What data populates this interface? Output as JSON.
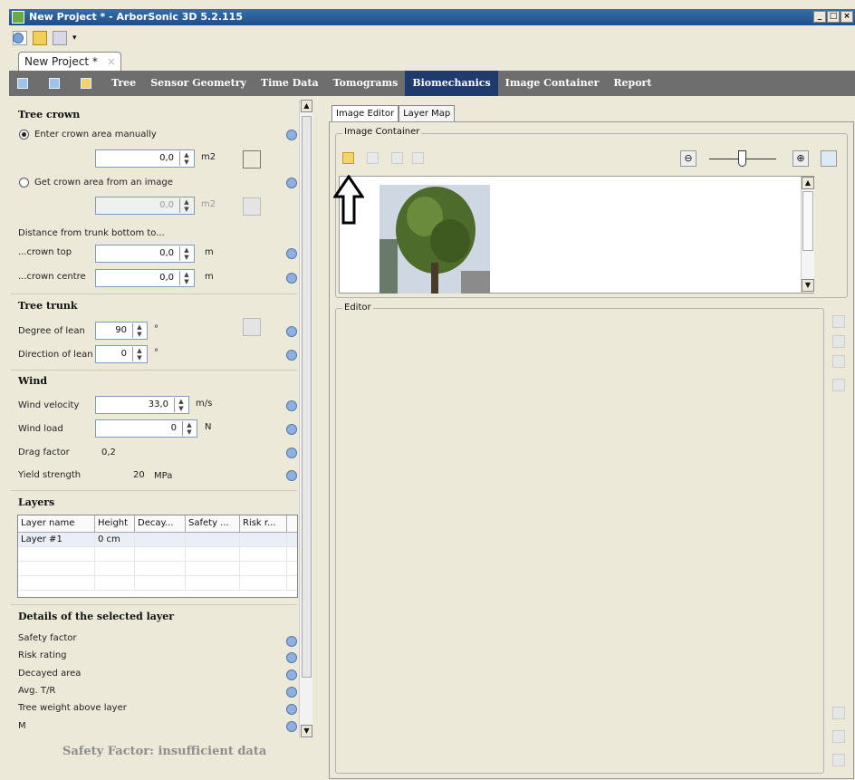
{
  "window": {
    "title": "New Project * - ArborSonic 3D 5.2.115",
    "buttons": [
      "_",
      "□",
      "×"
    ]
  },
  "doc_tab": {
    "label": "New Project *",
    "close": "×"
  },
  "menu": {
    "items": [
      "Tree",
      "Sensor Geometry",
      "Time Data",
      "Tomograms",
      "Biomechanics",
      "Image Container",
      "Report"
    ],
    "active": "Biomechanics"
  },
  "left": {
    "tree_crown": {
      "title": "Tree crown",
      "radio_manual": "Enter crown area manually",
      "manual_value": "0,0",
      "manual_unit": "m2",
      "radio_image": "Get crown area from an image",
      "image_value": "0,0",
      "image_unit": "m2",
      "distance_label": "Distance from trunk bottom to...",
      "crown_top_label": "...crown top",
      "crown_top_value": "0,0",
      "crown_top_unit": "m",
      "crown_centre_label": "...crown centre",
      "crown_centre_value": "0,0",
      "crown_centre_unit": "m"
    },
    "tree_trunk": {
      "title": "Tree trunk",
      "lean_degree_label": "Degree of lean",
      "lean_degree_value": "90",
      "lean_degree_unit": "°",
      "lean_dir_label": "Direction of lean",
      "lean_dir_value": "0",
      "lean_dir_unit": "°"
    },
    "wind": {
      "title": "Wind",
      "velocity_label": "Wind velocity",
      "velocity_value": "33,0",
      "velocity_unit": "m/s",
      "load_label": "Wind load",
      "load_value": "0",
      "load_unit": "N",
      "drag_label": "Drag factor",
      "drag_value": "0,2",
      "yield_label": "Yield strength",
      "yield_value": "20",
      "yield_unit": "MPa"
    },
    "layers": {
      "title": "Layers",
      "columns": [
        "Layer name",
        "Height",
        "Decay...",
        "Safety ...",
        "Risk r..."
      ],
      "rows": [
        [
          "Layer #1",
          "0 cm",
          "",
          "",
          ""
        ],
        [
          "",
          "",
          "",
          "",
          ""
        ],
        [
          "",
          "",
          "",
          "",
          ""
        ],
        [
          "",
          "",
          "",
          "",
          ""
        ]
      ]
    },
    "details": {
      "title": "Details of the selected layer",
      "items": [
        "Safety factor",
        "Risk rating",
        "Decayed area",
        "Avg. T/R",
        "Tree weight above layer",
        "M"
      ]
    },
    "status": "Safety Factor: insufficient data"
  },
  "right": {
    "tabs": [
      "Image Editor",
      "Layer Map"
    ],
    "active_tab": "Image Editor",
    "image_container_label": "Image Container",
    "editor_label": "Editor",
    "zoom_level": 0.5
  },
  "colors": {
    "menubar": "#6e6e6e",
    "menu_active": "#1f3a6d",
    "title_gradient_top": "#3a6ea5"
  }
}
